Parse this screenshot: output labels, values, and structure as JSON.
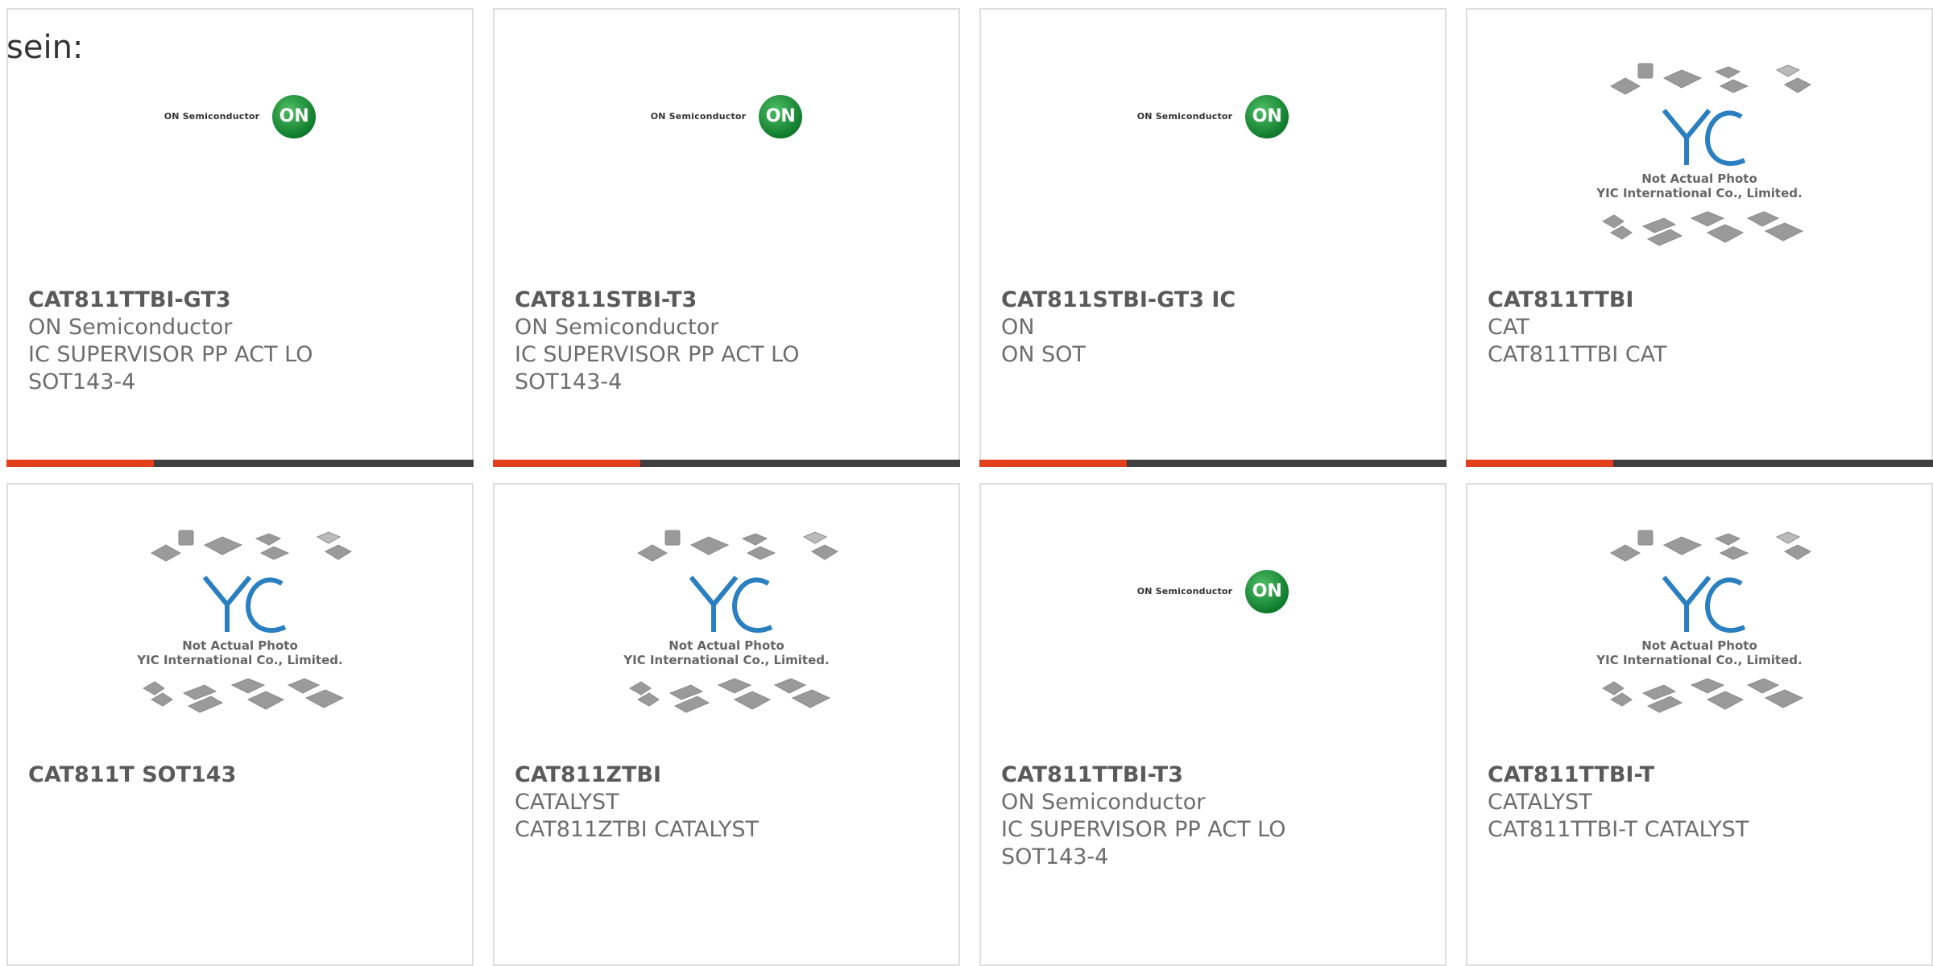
{
  "intro_text": "sein:",
  "yic_caption": {
    "line1": "Not Actual Photo",
    "line2": "YIC International Co., Limited."
  },
  "on_logo": {
    "text": "ON Semiconductor",
    "mark": "ON"
  },
  "products": [
    {
      "part": "CAT811TTBI-GT3",
      "lines": [
        "ON Semiconductor",
        "IC SUPERVISOR PP ACT LO",
        "SOT143-4"
      ],
      "image": "on-semiconductor-logo"
    },
    {
      "part": "CAT811STBI-T3",
      "lines": [
        "ON Semiconductor",
        "IC SUPERVISOR PP ACT LO",
        "SOT143-4"
      ],
      "image": "on-semiconductor-logo"
    },
    {
      "part": "CAT811STBI-GT3 IC",
      "lines": [
        "ON",
        "ON SOT",
        ""
      ],
      "image": "on-semiconductor-logo"
    },
    {
      "part": "CAT811TTBI",
      "lines": [
        "CAT",
        "CAT811TTBI CAT",
        ""
      ],
      "image": "yic-placeholder"
    },
    {
      "part": "CAT811T SOT143",
      "lines": [
        "",
        "",
        ""
      ],
      "image": "yic-placeholder"
    },
    {
      "part": "CAT811ZTBI",
      "lines": [
        "CATALYST",
        "CAT811ZTBI CATALYST",
        ""
      ],
      "image": "yic-placeholder"
    },
    {
      "part": "CAT811TTBI-T3",
      "lines": [
        "ON Semiconductor",
        "IC SUPERVISOR PP ACT LO",
        "SOT143-4"
      ],
      "image": "on-semiconductor-logo"
    },
    {
      "part": "CAT811TTBI-T",
      "lines": [
        "CATALYST",
        "CAT811TTBI-T CATALYST",
        ""
      ],
      "image": "yic-placeholder"
    }
  ],
  "colors": {
    "accent": "#e2401a",
    "bar": "#3f3f3f",
    "on_green": "#0f7b2d",
    "yic_blue": "#2a7fc1"
  }
}
